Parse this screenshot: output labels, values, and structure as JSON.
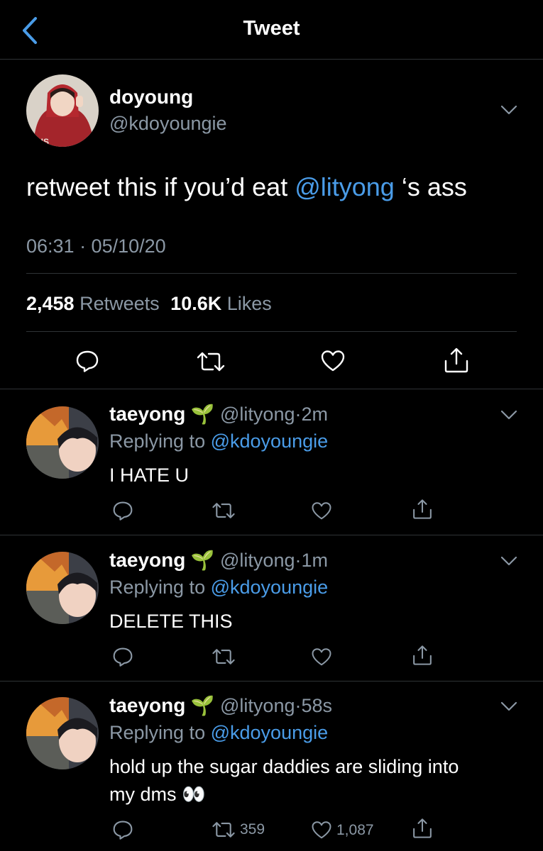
{
  "header": {
    "title": "Tweet",
    "back_icon": "chevron-left-icon"
  },
  "main_tweet": {
    "author_name": "doyoung",
    "author_handle": "@kdoyoungie",
    "text_before": "retweet this if you’d eat ",
    "mention": "@lityong",
    "text_after": " ‘s ass",
    "timestamp": "06:31 · 05/10/20",
    "retweet_count": "2,458",
    "retweet_label": "Retweets",
    "like_count": "10.6K",
    "like_label": "Likes"
  },
  "replies": [
    {
      "name": "taeyong",
      "emoji": "🌱",
      "handle": "@lityong",
      "time": "2m",
      "replying_label": "Replying to",
      "replying_handle": "@kdoyoungie",
      "text": "I HATE U",
      "retweet_count": "",
      "like_count": ""
    },
    {
      "name": "taeyong",
      "emoji": "🌱",
      "handle": "@lityong",
      "time": "1m",
      "replying_label": "Replying to",
      "replying_handle": "@kdoyoungie",
      "text": "DELETE THIS",
      "retweet_count": "",
      "like_count": ""
    },
    {
      "name": "taeyong",
      "emoji": "🌱",
      "handle": "@lityong",
      "time": "58s",
      "replying_label": "Replying to",
      "replying_handle": "@kdoyoungie",
      "text_line1": "hold up the sugar daddies are sliding into",
      "text_line2": "my dms",
      "text_emoji": "👀",
      "retweet_count": "359",
      "like_count": "1,087"
    }
  ],
  "colors": {
    "background": "#000000",
    "link": "#4a9ce8",
    "secondary_text": "#8b98a5",
    "divider": "#2f3336"
  }
}
